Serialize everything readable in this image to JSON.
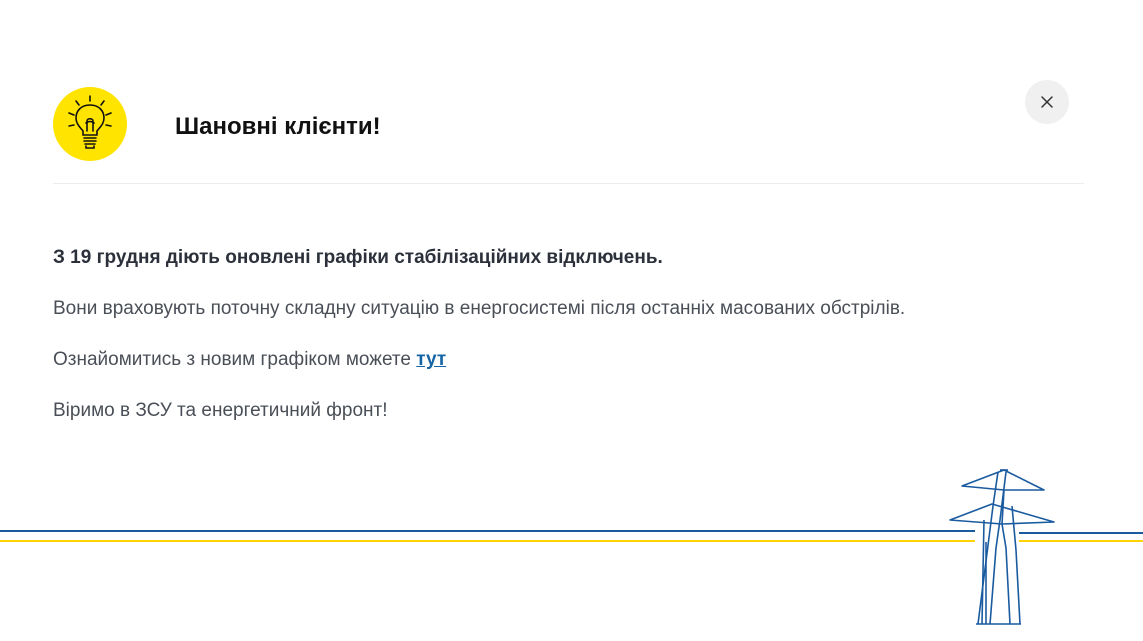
{
  "dialog": {
    "title": "Шановні клієнти!",
    "icon": "lightbulb-icon",
    "icon_bg_color": "#ffe400",
    "close_icon": "close-icon"
  },
  "content": {
    "lead": "З 19 грудня діють оновлені графіки стабілізаційних відключень.",
    "paragraph_1": "Вони враховують поточну складну ситуацію в енергосистемі після останніх масованих обстрілів.",
    "link_prefix": "Ознайомитись з новим графіком можете ",
    "link_text": "тут",
    "closing": "Віримо в ЗСУ та енергетичний фронт!"
  },
  "decoration": {
    "icon": "power-pylon-icon",
    "line_blue": "#1a5ba0",
    "line_yellow": "#ffd200"
  }
}
